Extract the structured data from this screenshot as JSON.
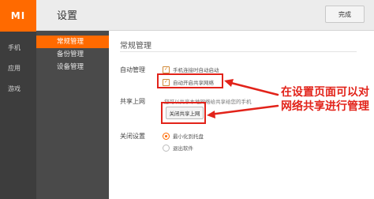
{
  "app": {
    "logo_text": "MI",
    "brand_color": "#ff6a00",
    "nav": [
      {
        "label": "手机"
      },
      {
        "label": "应用"
      },
      {
        "label": "游戏"
      }
    ]
  },
  "header": {
    "title": "设置",
    "done_label": "完成"
  },
  "settings_nav": {
    "items": [
      {
        "label": "常规管理",
        "active": true
      },
      {
        "label": "备份管理",
        "active": false
      },
      {
        "label": "设备管理",
        "active": false
      }
    ]
  },
  "main": {
    "section_title": "常规管理",
    "auto_manage": {
      "label": "自动管理",
      "options": [
        {
          "label": "手机连接时自动启动",
          "checked": true
        },
        {
          "label": "自动开启共享网络",
          "checked": true
        }
      ]
    },
    "share_network": {
      "label": "共享上网",
      "description": "您可以共享本地网络给共享给您的手机",
      "button_label": "关闭共享上网"
    },
    "close_settings": {
      "label": "关闭设置",
      "options": [
        {
          "label": "最小化到托盘",
          "selected": true
        },
        {
          "label": "退出软件",
          "selected": false
        }
      ]
    }
  },
  "annotation": {
    "text": "在设置页面可以对网络共享进行管理",
    "color": "#e2231a"
  }
}
